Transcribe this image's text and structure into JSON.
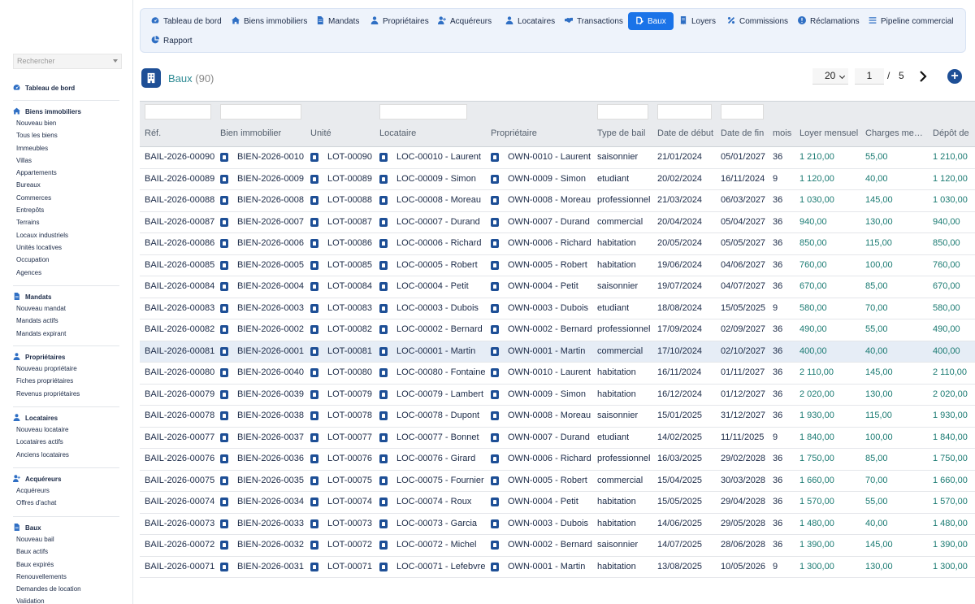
{
  "sidebar": {
    "search_placeholder": "Rechercher",
    "sections": [
      {
        "icon": "dashboard-icon",
        "title": "Tableau de bord",
        "items": []
      },
      {
        "icon": "house-icon",
        "title": "Biens immobiliers",
        "items": [
          "Nouveau bien",
          "Tous les biens",
          "Immeubles",
          "Villas",
          "Appartements",
          "Bureaux",
          "Commerces",
          "Entrepôts",
          "Terrains",
          "Locaux industriels",
          "Unités locatives",
          "Occupation",
          "Agences"
        ]
      },
      {
        "icon": "document-icon",
        "title": "Mandats",
        "items": [
          "Nouveau mandat",
          "Mandats actifs",
          "Mandats expirant"
        ]
      },
      {
        "icon": "user-icon",
        "title": "Propriétaires",
        "items": [
          "Nouveau propriétaire",
          "Fiches propriétaires",
          "Revenus propriétaires"
        ]
      },
      {
        "icon": "user-icon",
        "title": "Locataires",
        "items": [
          "Nouveau locataire",
          "Locataires actifs",
          "Anciens locataires"
        ]
      },
      {
        "icon": "user-plus-icon",
        "title": "Acquéreurs",
        "items": [
          "Acquéreurs",
          "Offres d'achat"
        ]
      },
      {
        "icon": "document-icon",
        "title": "Baux",
        "items": [
          "Nouveau bail",
          "Baux actifs",
          "Baux expirés",
          "Renouvellements",
          "Demandes de location",
          "Validation"
        ]
      }
    ]
  },
  "topnav": [
    {
      "label": "Tableau de bord",
      "icon": "dashboard-icon",
      "active": false
    },
    {
      "label": "Biens immobiliers",
      "icon": "house-icon",
      "active": false
    },
    {
      "label": "Mandats",
      "icon": "document-icon",
      "active": false
    },
    {
      "label": "Propriétaires",
      "icon": "user-icon",
      "active": false
    },
    {
      "label": "Acquéreurs",
      "icon": "user-plus-icon",
      "active": false
    },
    {
      "label": "Locataires",
      "icon": "user-icon",
      "active": false
    },
    {
      "label": "Transactions",
      "icon": "handshake-icon",
      "active": false
    },
    {
      "label": "Baux",
      "icon": "signature-icon",
      "active": true
    },
    {
      "label": "Loyers",
      "icon": "receipt-icon",
      "active": false
    },
    {
      "label": "Commissions",
      "icon": "percent-icon",
      "active": false
    },
    {
      "label": "Réclamations",
      "icon": "alert-icon",
      "active": false
    },
    {
      "label": "Pipeline commercial",
      "icon": "list-icon",
      "active": false
    },
    {
      "label": "Rapport",
      "icon": "pie-chart-icon",
      "active": false
    }
  ],
  "page": {
    "title": "Baux",
    "count": "(90)",
    "icon": "building-icon"
  },
  "pager": {
    "per_page": "20",
    "current_page": "1",
    "separator": "/",
    "total_pages": "5"
  },
  "colors": {
    "accent": "#1a73e8",
    "dark_blue": "#1e4f96",
    "title_teal": "#2d8a93",
    "money_teal": "#1a7a72",
    "nav_bg": "#eef3fb",
    "highlight_row": "#e6edf6"
  },
  "table": {
    "columns": [
      "Réf.",
      "Bien immobilier",
      "Unité",
      "Locataire",
      "Propriétaire",
      "Type de bail",
      "Date de début",
      "Date de fin",
      "mois",
      "Loyer mensuel",
      "Charges me…",
      "Dépôt de"
    ],
    "rows": [
      [
        "BAIL-2026-00090",
        "BIEN-2026-0010",
        "LOT-00090",
        "LOC-00010 - Laurent",
        "OWN-0010 - Laurent",
        "saisonnier",
        "21/01/2024",
        "05/01/2027",
        "36",
        "1 210,00",
        "55,00",
        "1 210,00"
      ],
      [
        "BAIL-2026-00089",
        "BIEN-2026-0009",
        "LOT-00089",
        "LOC-00009 - Simon",
        "OWN-0009 - Simon",
        "etudiant",
        "20/02/2024",
        "16/11/2024",
        "9",
        "1 120,00",
        "40,00",
        "1 120,00"
      ],
      [
        "BAIL-2026-00088",
        "BIEN-2026-0008",
        "LOT-00088",
        "LOC-00008 - Moreau",
        "OWN-0008 - Moreau",
        "professionnel",
        "21/03/2024",
        "06/03/2027",
        "36",
        "1 030,00",
        "145,00",
        "1 030,00"
      ],
      [
        "BAIL-2026-00087",
        "BIEN-2026-0007",
        "LOT-00087",
        "LOC-00007 - Durand",
        "OWN-0007 - Durand",
        "commercial",
        "20/04/2024",
        "05/04/2027",
        "36",
        "940,00",
        "130,00",
        "940,00"
      ],
      [
        "BAIL-2026-00086",
        "BIEN-2026-0006",
        "LOT-00086",
        "LOC-00006 - Richard",
        "OWN-0006 - Richard",
        "habitation",
        "20/05/2024",
        "05/05/2027",
        "36",
        "850,00",
        "115,00",
        "850,00"
      ],
      [
        "BAIL-2026-00085",
        "BIEN-2026-0005",
        "LOT-00085",
        "LOC-00005 - Robert",
        "OWN-0005 - Robert",
        "habitation",
        "19/06/2024",
        "04/06/2027",
        "36",
        "760,00",
        "100,00",
        "760,00"
      ],
      [
        "BAIL-2026-00084",
        "BIEN-2026-0004",
        "LOT-00084",
        "LOC-00004 - Petit",
        "OWN-0004 - Petit",
        "saisonnier",
        "19/07/2024",
        "04/07/2027",
        "36",
        "670,00",
        "85,00",
        "670,00"
      ],
      [
        "BAIL-2026-00083",
        "BIEN-2026-0003",
        "LOT-00083",
        "LOC-00003 - Dubois",
        "OWN-0003 - Dubois",
        "etudiant",
        "18/08/2024",
        "15/05/2025",
        "9",
        "580,00",
        "70,00",
        "580,00"
      ],
      [
        "BAIL-2026-00082",
        "BIEN-2026-0002",
        "LOT-00082",
        "LOC-00002 - Bernard",
        "OWN-0002 - Bernard",
        "professionnel",
        "17/09/2024",
        "02/09/2027",
        "36",
        "490,00",
        "55,00",
        "490,00"
      ],
      [
        "BAIL-2026-00081",
        "BIEN-2026-0001",
        "LOT-00081",
        "LOC-00001 - Martin",
        "OWN-0001 - Martin",
        "commercial",
        "17/10/2024",
        "02/10/2027",
        "36",
        "400,00",
        "40,00",
        "400,00"
      ],
      [
        "BAIL-2026-00080",
        "BIEN-2026-0040",
        "LOT-00080",
        "LOC-00080 - Fontaine",
        "OWN-0010 - Laurent",
        "habitation",
        "16/11/2024",
        "01/11/2027",
        "36",
        "2 110,00",
        "145,00",
        "2 110,00"
      ],
      [
        "BAIL-2026-00079",
        "BIEN-2026-0039",
        "LOT-00079",
        "LOC-00079 - Lambert",
        "OWN-0009 - Simon",
        "habitation",
        "16/12/2024",
        "01/12/2027",
        "36",
        "2 020,00",
        "130,00",
        "2 020,00"
      ],
      [
        "BAIL-2026-00078",
        "BIEN-2026-0038",
        "LOT-00078",
        "LOC-00078 - Dupont",
        "OWN-0008 - Moreau",
        "saisonnier",
        "15/01/2025",
        "31/12/2027",
        "36",
        "1 930,00",
        "115,00",
        "1 930,00"
      ],
      [
        "BAIL-2026-00077",
        "BIEN-2026-0037",
        "LOT-00077",
        "LOC-00077 - Bonnet",
        "OWN-0007 - Durand",
        "etudiant",
        "14/02/2025",
        "11/11/2025",
        "9",
        "1 840,00",
        "100,00",
        "1 840,00"
      ],
      [
        "BAIL-2026-00076",
        "BIEN-2026-0036",
        "LOT-00076",
        "LOC-00076 - Girard",
        "OWN-0006 - Richard",
        "professionnel",
        "16/03/2025",
        "29/02/2028",
        "36",
        "1 750,00",
        "85,00",
        "1 750,00"
      ],
      [
        "BAIL-2026-00075",
        "BIEN-2026-0035",
        "LOT-00075",
        "LOC-00075 - Fournier",
        "OWN-0005 - Robert",
        "commercial",
        "15/04/2025",
        "30/03/2028",
        "36",
        "1 660,00",
        "70,00",
        "1 660,00"
      ],
      [
        "BAIL-2026-00074",
        "BIEN-2026-0034",
        "LOT-00074",
        "LOC-00074 - Roux",
        "OWN-0004 - Petit",
        "habitation",
        "15/05/2025",
        "29/04/2028",
        "36",
        "1 570,00",
        "55,00",
        "1 570,00"
      ],
      [
        "BAIL-2026-00073",
        "BIEN-2026-0033",
        "LOT-00073",
        "LOC-00073 - Garcia",
        "OWN-0003 - Dubois",
        "habitation",
        "14/06/2025",
        "29/05/2028",
        "36",
        "1 480,00",
        "40,00",
        "1 480,00"
      ],
      [
        "BAIL-2026-00072",
        "BIEN-2026-0032",
        "LOT-00072",
        "LOC-00072 - Michel",
        "OWN-0002 - Bernard",
        "saisonnier",
        "14/07/2025",
        "28/06/2028",
        "36",
        "1 390,00",
        "145,00",
        "1 390,00"
      ],
      [
        "BAIL-2026-00071",
        "BIEN-2026-0031",
        "LOT-00071",
        "LOC-00071 - Lefebvre",
        "OWN-0001 - Martin",
        "habitation",
        "13/08/2025",
        "10/05/2026",
        "9",
        "1 300,00",
        "130,00",
        "1 300,00"
      ]
    ],
    "highlighted_row": 9
  }
}
